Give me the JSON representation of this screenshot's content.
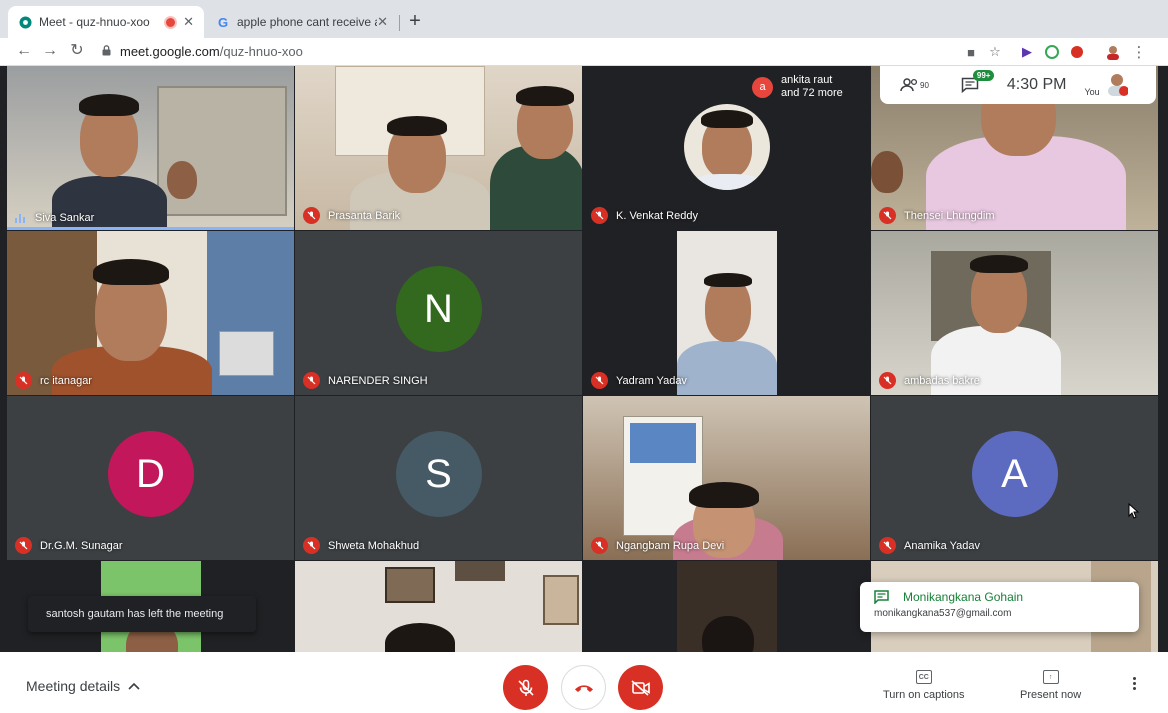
{
  "browser": {
    "tabs": [
      {
        "title": "Meet - quz-hnuo-xoo",
        "active": true,
        "recording": true
      },
      {
        "title": "apple phone cant receive airdrop",
        "active": false
      }
    ],
    "url_domain": "meet.google.com",
    "url_path": "/quz-hnuo-xoo"
  },
  "participants": [
    {
      "name": "Siva Sankar",
      "speaking": true
    },
    {
      "name": "Prasanta Barik",
      "muted": true
    },
    {
      "name": "K. Venkat Reddy",
      "muted": true
    },
    {
      "name": "Thensei Lhungdim",
      "muted": true
    },
    {
      "name": "rc itanagar",
      "muted": true
    },
    {
      "name": "NARENDER SINGH",
      "muted": true,
      "initial": "N",
      "color": "#33691e"
    },
    {
      "name": "Yadram Yadav",
      "muted": true
    },
    {
      "name": "ambadas bakre",
      "muted": true
    },
    {
      "name": "Dr.G.M. Sunagar",
      "muted": true,
      "initial": "D",
      "color": "#c2185b"
    },
    {
      "name": "Shweta Mohakhud",
      "muted": true,
      "initial": "S",
      "color": "#455a64"
    },
    {
      "name": "Ngangbam Rupa Devi",
      "muted": true
    },
    {
      "name": "Anamika Yadav",
      "muted": true,
      "initial": "A",
      "color": "#5c6bc0"
    }
  ],
  "join_notice": {
    "initial": "a",
    "line1": "ankita raut",
    "line2": "and 72 more"
  },
  "infobar": {
    "people_count": "90",
    "chat_badge": "99+",
    "time": "4:30 PM",
    "you_label": "You"
  },
  "toasts": {
    "left_message": "santosh gautam has left the meeting",
    "chat_sender": "Monikangkana Gohain",
    "chat_email": "monikangkana537@gmail.com"
  },
  "bottom": {
    "meeting_details": "Meeting details",
    "captions_label": "Turn on captions",
    "captions_icon": "CC",
    "present_label": "Present now"
  },
  "colors": {
    "mute_red": "#d93025",
    "speaking_blue": "#8ab4f8",
    "chat_green": "#1e8e3e"
  }
}
